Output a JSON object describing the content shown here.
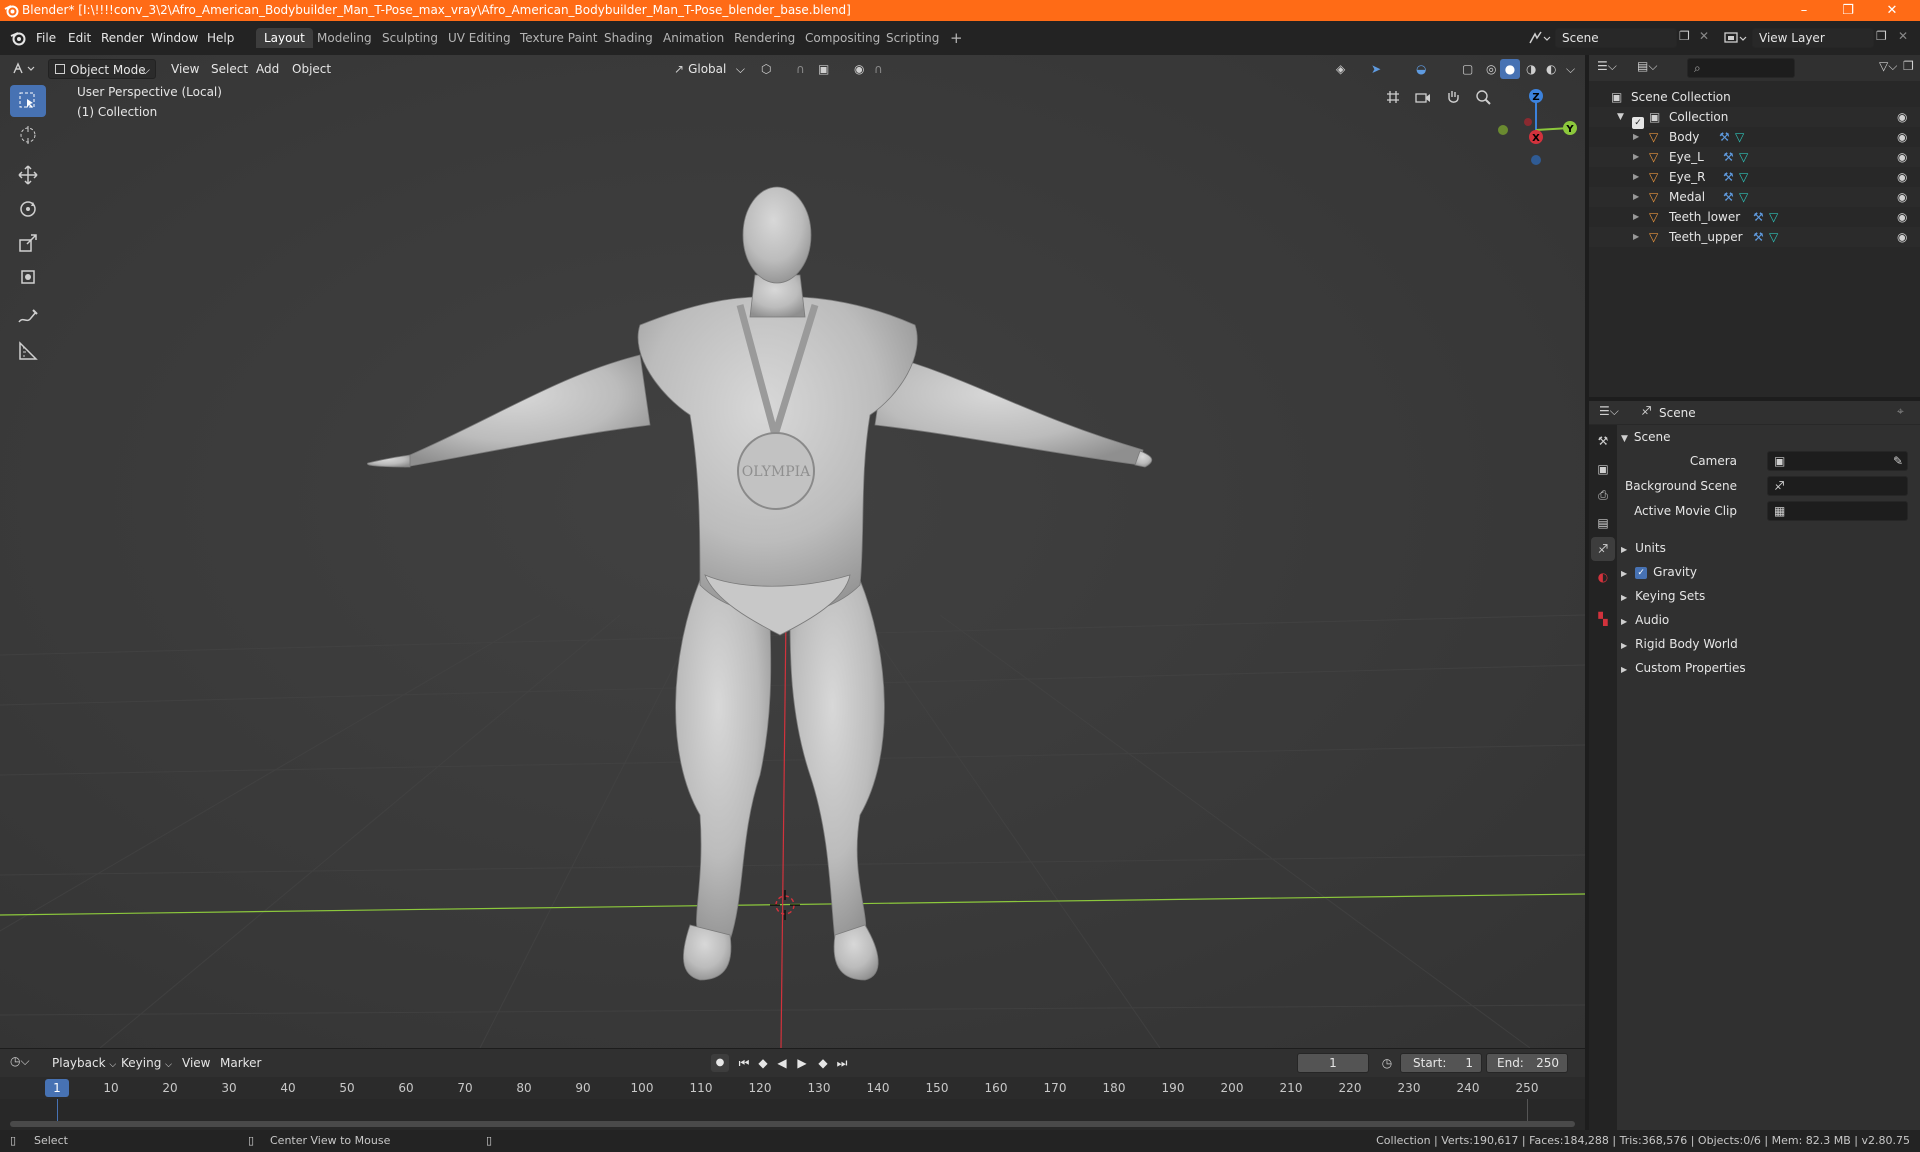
{
  "window": {
    "title": "Blender* [I:\\!!!!conv_3\\2\\Afro_American_Bodybuilder_Man_T-Pose_max_vray\\Afro_American_Bodybuilder_Man_T-Pose_blender_base.blend]",
    "controls": [
      "minimize",
      "maximize",
      "close"
    ]
  },
  "menubar": {
    "items": [
      "File",
      "Edit",
      "Render",
      "Window",
      "Help"
    ],
    "workspaces": [
      "Layout",
      "Modeling",
      "Sculpting",
      "UV Editing",
      "Texture Paint",
      "Shading",
      "Animation",
      "Rendering",
      "Compositing",
      "Scripting"
    ],
    "active_workspace": "Layout",
    "add_workspace": "+",
    "scene": "Scene",
    "view_layer": "View Layer"
  },
  "viewport": {
    "mode": "Object Mode",
    "menus": [
      "View",
      "Select",
      "Add",
      "Object"
    ],
    "orientation": "Global",
    "overlay_text": [
      "User Perspective (Local)",
      "(1) Collection"
    ],
    "gizmo_axes": [
      "X",
      "Y",
      "Z"
    ],
    "medal_text": "OLYMPIA",
    "axis_colors": {
      "x": "#d2323c",
      "y": "#8cc83c",
      "z": "#3c82dc"
    }
  },
  "tools": [
    "select-box",
    "cursor",
    "move",
    "rotate",
    "scale",
    "transform",
    "annotate",
    "measure"
  ],
  "outliner": {
    "root": "Scene Collection",
    "collection": "Collection",
    "objects": [
      "Body",
      "Eye_L",
      "Eye_R",
      "Medal",
      "Teeth_lower",
      "Teeth_upper"
    ]
  },
  "properties": {
    "context": "Scene",
    "panel_title": "Scene",
    "fields": [
      {
        "label": "Camera",
        "value": ""
      },
      {
        "label": "Background Scene",
        "value": ""
      },
      {
        "label": "Active Movie Clip",
        "value": ""
      }
    ],
    "subpanels": [
      {
        "label": "Units",
        "checkbox": false
      },
      {
        "label": "Gravity",
        "checkbox": true
      },
      {
        "label": "Keying Sets",
        "checkbox": false
      },
      {
        "label": "Audio",
        "checkbox": false
      },
      {
        "label": "Rigid Body World",
        "checkbox": false
      },
      {
        "label": "Custom Properties",
        "checkbox": false
      }
    ]
  },
  "timeline": {
    "menus": [
      "Playback",
      "Keying",
      "View",
      "Marker"
    ],
    "current_frame": "1",
    "start_label": "Start:",
    "start": "1",
    "end_label": "End:",
    "end": "250",
    "ticks": [
      "1",
      "10",
      "20",
      "30",
      "40",
      "50",
      "60",
      "70",
      "80",
      "90",
      "100",
      "110",
      "120",
      "130",
      "140",
      "150",
      "160",
      "170",
      "180",
      "190",
      "200",
      "210",
      "220",
      "230",
      "240",
      "250"
    ]
  },
  "statusbar": {
    "left": "Select",
    "middle": "Center View to Mouse",
    "right": "Collection | Verts:190,617 | Faces:184,288 | Tris:368,576 | Objects:0/6 | Mem: 82.3 MB | v2.80.75"
  },
  "colors": {
    "title_bar": "#ff6b16",
    "accent": "#4772b3",
    "object_icon": "#e8953e",
    "modifier_icon": "#5f9be0",
    "mesh_icon": "#2fc1b7"
  }
}
